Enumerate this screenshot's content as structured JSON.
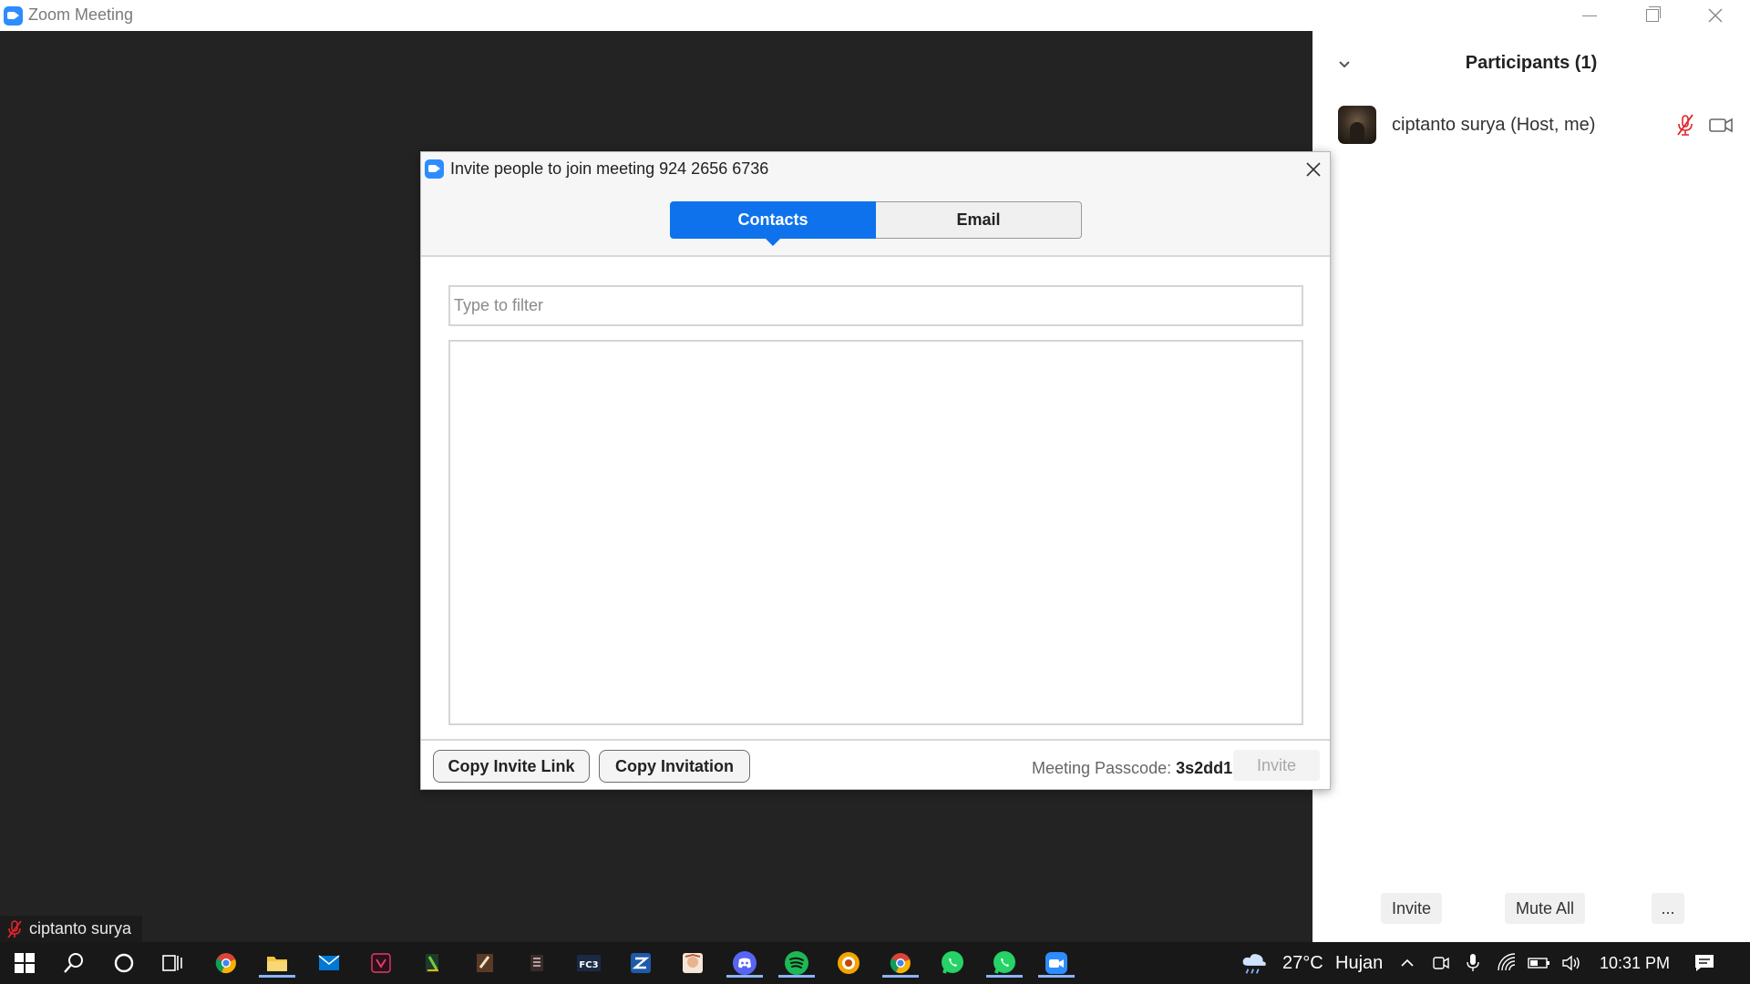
{
  "window": {
    "title": "Zoom Meeting",
    "icon": "zoom-logo-icon"
  },
  "self_view": {
    "name": "ciptanto surya",
    "mic_icon": "mic-muted-icon"
  },
  "participants_panel": {
    "title": "Participants (1)",
    "participants": [
      {
        "name": "ciptanto surya (Host, me)",
        "mic": "muted",
        "camera": "video-camera-icon"
      }
    ],
    "buttons": {
      "invite": "Invite",
      "mute_all": "Mute All",
      "more": "..."
    }
  },
  "invite_dialog": {
    "title": "Invite people to join meeting 924 2656 6736",
    "tabs": [
      {
        "label": "Contacts",
        "selected": true
      },
      {
        "label": "Email",
        "selected": false
      }
    ],
    "filter_placeholder": "Type to filter",
    "filter_value": "",
    "footer": {
      "copy_invite_link": "Copy Invite Link",
      "copy_invitation": "Copy Invitation",
      "passcode_label": "Meeting Passcode:",
      "passcode_value": "3s2dd1",
      "invite": "Invite"
    }
  },
  "taskbar": {
    "apps": [
      "windows-start-icon",
      "search-icon",
      "cortana-icon",
      "task-view-icon",
      "chrome-icon",
      "file-explorer-icon",
      "mail-icon",
      "vivaldi-icon",
      "app-icon",
      "app-icon",
      "app-icon",
      "fc3-icon",
      "app-icon",
      "app-icon",
      "discord-icon",
      "spotify-icon",
      "app-icon",
      "chrome-icon",
      "whatsapp-icon",
      "whatsapp-icon",
      "zoom-icon"
    ],
    "weather_temp": "27°C",
    "weather_desc": "Hujan",
    "time": "10:31 PM",
    "colors": {
      "accent": "#0e72ed",
      "zoom_blue": "#2D8CFF",
      "muted_red": "#e0242a"
    }
  }
}
